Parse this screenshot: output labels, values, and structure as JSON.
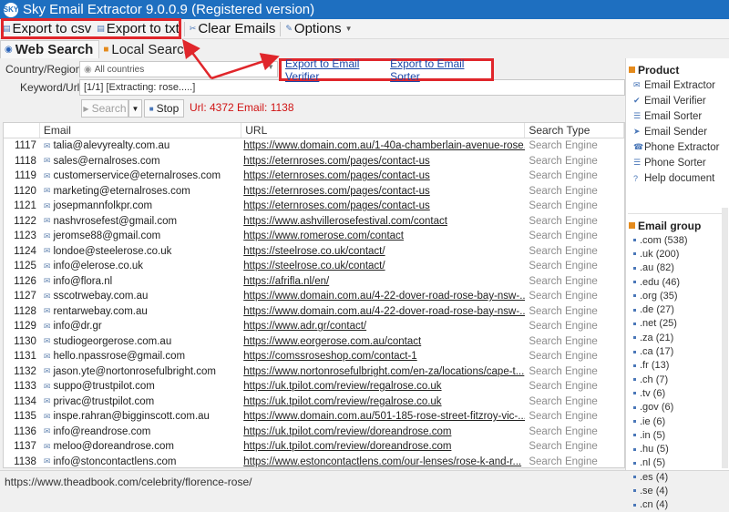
{
  "window": {
    "title": "Sky Email Extractor 9.0.0.9 (Registered version)",
    "icon": "sky-logo-icon"
  },
  "toolbar": {
    "export_csv": "Export to csv",
    "export_txt": "Export to txt",
    "clear_emails": "Clear Emails",
    "options": "Options"
  },
  "tabs": {
    "web_search": "Web Search",
    "local_search": "Local Search"
  },
  "form": {
    "country_label": "Country/Region:",
    "country_value": "All countries",
    "keyword_label": "Keyword/Url:",
    "keyword_value": "[1/1] [Extracting: rose.....]",
    "search_button": "Search",
    "stop_button": "Stop",
    "status_text": "Url: 4372 Email: 1138"
  },
  "export_links": {
    "verifier": "Export to Email Verifier",
    "sorter": "Export to Email Sorter"
  },
  "grid": {
    "columns": {
      "email": "Email",
      "url": "URL",
      "type": "Search Type"
    },
    "rows": [
      {
        "n": "1117",
        "email": "talia@alevyrealty.com.au",
        "url": "https://www.domain.com.au/1-40a-chamberlain-avenue-rose...",
        "type": "Search Engine"
      },
      {
        "n": "1118",
        "email": "sales@ernalroses.com",
        "url": "https://eternroses.com/pages/contact-us",
        "type": "Search Engine"
      },
      {
        "n": "1119",
        "email": "customerservice@eternalroses.com",
        "url": "https://eternroses.com/pages/contact-us",
        "type": "Search Engine"
      },
      {
        "n": "1120",
        "email": "marketing@eternalroses.com",
        "url": "https://eternroses.com/pages/contact-us",
        "type": "Search Engine"
      },
      {
        "n": "1121",
        "email": "josepmannfolkpr.com",
        "url": "https://eternroses.com/pages/contact-us",
        "type": "Search Engine"
      },
      {
        "n": "1122",
        "email": "nashvrosefest@gmail.com",
        "url": "https://www.ashvillerosefestival.com/contact",
        "type": "Search Engine"
      },
      {
        "n": "1123",
        "email": "jeromse88@gmail.com",
        "url": "https://www.romerose.com/contact",
        "type": "Search Engine"
      },
      {
        "n": "1124",
        "email": "londoe@steelerose.co.uk",
        "url": "https://steelrose.co.uk/contact/",
        "type": "Search Engine"
      },
      {
        "n": "1125",
        "email": "info@elerose.co.uk",
        "url": "https://steelrose.co.uk/contact/",
        "type": "Search Engine"
      },
      {
        "n": "1126",
        "email": "info@flora.nl",
        "url": "https://afrifla.nl/en/",
        "type": "Search Engine"
      },
      {
        "n": "1127",
        "email": "sscotrwebay.com.au",
        "url": "https://www.domain.com.au/4-22-dover-road-rose-bay-nsw-...",
        "type": "Search Engine"
      },
      {
        "n": "1128",
        "email": "rentarwebay.com.au",
        "url": "https://www.domain.com.au/4-22-dover-road-rose-bay-nsw-...",
        "type": "Search Engine"
      },
      {
        "n": "1129",
        "email": "info@dr.gr",
        "url": "https://www.adr.gr/contact/",
        "type": "Search Engine"
      },
      {
        "n": "1130",
        "email": "studiogeorgerose.com.au",
        "url": "https://www.eorgerose.com.au/contact",
        "type": "Search Engine"
      },
      {
        "n": "1131",
        "email": "hello.npassrose@gmail.com",
        "url": "https://comssroseshop.com/contact-1",
        "type": "Search Engine"
      },
      {
        "n": "1132",
        "email": "jason.yte@nortonrosefulbright.com",
        "url": "https://www.nortonrosefulbright.com/en-za/locations/cape-t...",
        "type": "Search Engine"
      },
      {
        "n": "1133",
        "email": "suppo@trustpilot.com",
        "url": "https://uk.tpilot.com/review/regalrose.co.uk",
        "type": "Search Engine"
      },
      {
        "n": "1134",
        "email": "privac@trustpilot.com",
        "url": "https://uk.tpilot.com/review/regalrose.co.uk",
        "type": "Search Engine"
      },
      {
        "n": "1135",
        "email": "inspe.rahran@bigginscott.com.au",
        "url": "https://www.domain.com.au/501-185-rose-street-fitzroy-vic-...",
        "type": "Search Engine"
      },
      {
        "n": "1136",
        "email": "info@reandrose.com",
        "url": "https://uk.tpilot.com/review/doreandrose.com",
        "type": "Search Engine"
      },
      {
        "n": "1137",
        "email": "meloo@doreandrose.com",
        "url": "https://uk.tpilot.com/review/doreandrose.com",
        "type": "Search Engine"
      },
      {
        "n": "1138",
        "email": "info@stoncontactlens.com",
        "url": "https://www.estoncontactlens.com/our-lenses/rose-k-and-r...",
        "type": "Search Engine"
      }
    ]
  },
  "status_url": "https://www.theadbook.com/celebrity/florence-rose/",
  "product": {
    "heading": "Product",
    "items": [
      {
        "label": "Email Extractor",
        "icon": "mail-icon"
      },
      {
        "label": "Email Verifier",
        "icon": "check-icon"
      },
      {
        "label": "Email Sorter",
        "icon": "sort-icon"
      },
      {
        "label": "Email Sender",
        "icon": "send-icon"
      },
      {
        "label": "Phone Extractor",
        "icon": "phone-icon"
      },
      {
        "label": "Phone Sorter",
        "icon": "sort-icon"
      },
      {
        "label": "Help document",
        "icon": "help-icon"
      }
    ]
  },
  "email_group": {
    "heading": "Email group",
    "items": [
      ".com (538)",
      ".uk (200)",
      ".au (82)",
      ".edu (46)",
      ".org (35)",
      ".de (27)",
      ".net (25)",
      ".za (21)",
      ".ca (17)",
      ".fr (13)",
      ".ch (7)",
      ".tv (6)",
      ".gov (6)",
      ".ie (6)",
      ".in (5)",
      ".hu (5)",
      ".nl (5)",
      ".es (4)",
      ".se (4)",
      ".cn (4)"
    ]
  },
  "colors": {
    "titlebar": "#1e6fc0",
    "annotation": "#e0262b",
    "link": "#1b46a8",
    "status_red": "#d01414"
  }
}
